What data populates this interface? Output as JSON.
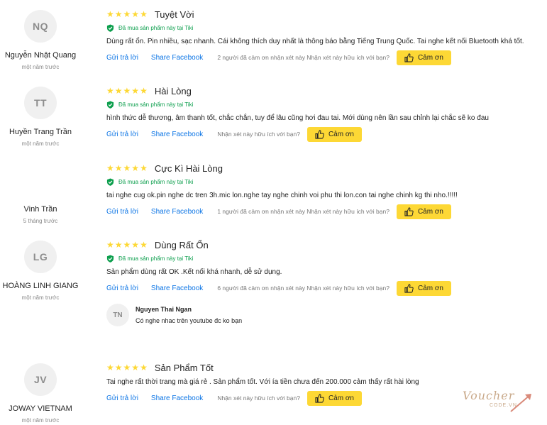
{
  "reviews": [
    {
      "initials": "NQ",
      "name": "Nguyễn Nhật Quang",
      "time": "một năm trước",
      "rating": 5,
      "title": "Tuyệt Vời",
      "bought": "Đã mua sản phẩm này tại Tiki",
      "text": "Dùng rất ổn. Pin nhiều, sạc nhanh. Cái không thích duy nhất là thông báo bằng Tiếng Trung Quốc. Tai nghe kết nối Bluetooth khá tốt.",
      "reply": "Gửi trả lời",
      "share": "Share Facebook",
      "helpful": "2 người đã cảm ơn nhận xét này Nhận xét này hữu ích với bạn?",
      "thanks": "Cảm ơn"
    },
    {
      "initials": "TT",
      "name": "Huyền Trang Trần",
      "time": "một năm trước",
      "rating": 5,
      "title": "Hài Lòng",
      "bought": "Đã mua sản phẩm này tại Tiki",
      "text": "hình thức dễ thương, âm thanh tốt, chắc chắn, tuy để lâu cũng hơi đau tai. Mới dùng nên lần sau chỉnh lại chắc sẽ ko đau",
      "reply": "Gửi trả lời",
      "share": "Share Facebook",
      "helpful": "Nhận xét này hữu ích với bạn?",
      "thanks": "Cảm ơn"
    },
    {
      "initials": "",
      "name": "Vinh Trần",
      "time": "5 tháng trước",
      "rating": 5,
      "title": "Cực Kì Hài Lòng",
      "bought": "Đã mua sản phẩm này tại Tiki",
      "text": "tai nghe cug ok.pin nghe dc tren 3h.mic lon.nghe tay nghe chinh voi phu thi lon.con tai nghe chinh kg thi nho.!!!!!",
      "reply": "Gửi trả lời",
      "share": "Share Facebook",
      "helpful": "1 người đã cảm ơn nhận xét này Nhận xét này hữu ích với bạn?",
      "thanks": "Cảm ơn"
    },
    {
      "initials": "LG",
      "name": "HOÀNG LINH GIANG",
      "time": "một năm trước",
      "rating": 5,
      "title": "Dùng Rất Ổn",
      "bought": "Đã mua sản phẩm này tại Tiki",
      "text": "Sản phẩm dùng rất OK .Kết nối khá nhanh, dễ sử dụng.",
      "reply": "Gửi trả lời",
      "share": "Share Facebook",
      "helpful": "6 người đã cảm ơn nhận xét này Nhận xét này hữu ích với bạn?",
      "thanks": "Cảm ơn"
    },
    {
      "initials": "JV",
      "name": "JOWAY VIETNAM",
      "time": "một năm trước",
      "rating": 5,
      "title": "Sản Phẩm Tốt",
      "bought": "",
      "text": "Tai nghe rất thời trang mà giá rẻ . Sản phẩm tốt. Với ía tiền chưa đến 200.000 cảm thấy rất hài lòng",
      "reply": "Gửi trả lời",
      "share": "Share Facebook",
      "helpful": "Nhận xét này hữu ích với bạn?",
      "thanks": "Cảm ơn"
    }
  ],
  "subreply": {
    "initials": "TN",
    "name": "Nguyen Thai Ngan",
    "text": "Có nghe nhac trên youtube đc ko bạn"
  },
  "watermark": {
    "line1": "Voucher",
    "line2": "CODE.VN"
  },
  "colors": {
    "star": "#fdd835",
    "link": "#0b74e5",
    "verified": "#0b9e4c",
    "button": "#fdd835"
  }
}
